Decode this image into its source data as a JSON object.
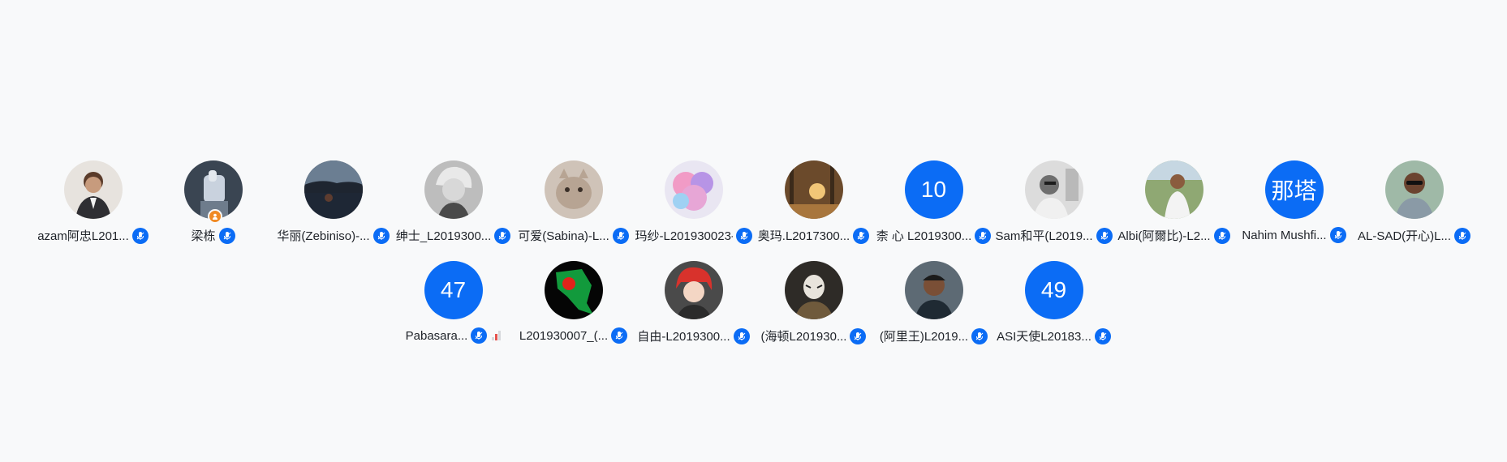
{
  "participants_row1": [
    {
      "name": "azam阿忠L201...",
      "avatar": "photo-man-suit",
      "icon": "mic-icon"
    },
    {
      "name": "梁栋",
      "avatar": "photo-hand-figure",
      "icon": "mic-icon",
      "host": true
    },
    {
      "name": "华丽(Zebiniso)-...",
      "avatar": "photo-sunset-lake",
      "icon": "mic-icon"
    },
    {
      "name": "绅士_L2019300...",
      "avatar": "photo-bw-portrait",
      "icon": "mic-icon"
    },
    {
      "name": "可爱(Sabina)-L...",
      "avatar": "photo-cat",
      "icon": "mic-icon"
    },
    {
      "name": "玛纱-L201930023-...",
      "avatar": "photo-pink-clouds",
      "icon": "mic-icon"
    },
    {
      "name": "奥玛.L2017300...",
      "avatar": "photo-autumn-forest",
      "icon": "mic-icon"
    },
    {
      "name": "柰 心 L2019300...",
      "avatar_text": "10",
      "icon": "mic-icon"
    },
    {
      "name": "Sam和平(L2019...",
      "avatar": "photo-bw-man",
      "icon": "mic-icon"
    },
    {
      "name": "Albi(阿爾比)-L2...",
      "avatar": "photo-man-outdoor",
      "icon": "mic-icon"
    },
    {
      "name": "Nahim Mushfi...",
      "avatar_text": "那塔",
      "icon": "mic-icon"
    },
    {
      "name": "AL-SAD(开心)L...",
      "avatar": "photo-man-sunglasses",
      "icon": "mic-icon"
    }
  ],
  "participants_row2": [
    {
      "name": "Pabasara...",
      "avatar_text": "47",
      "icon": "mic-icon",
      "signal": true
    },
    {
      "name": "L201930007_(...",
      "avatar": "photo-green-map",
      "icon": "mic-icon"
    },
    {
      "name": "自由-L2019300...",
      "avatar": "photo-anime-boy",
      "icon": "mic-icon"
    },
    {
      "name": "(海顿L201930...",
      "avatar": "photo-mask-man",
      "icon": "mic-icon"
    },
    {
      "name": "(阿里王)L2019...",
      "avatar": "photo-man-dark",
      "icon": "mic-icon"
    },
    {
      "name": "ASI天使L20183...",
      "avatar_text": "49",
      "icon": "mic-icon"
    }
  ],
  "colors": {
    "accent": "#0b6cf5",
    "background": "#f8f9fa",
    "host_badge": "#f08a24"
  }
}
